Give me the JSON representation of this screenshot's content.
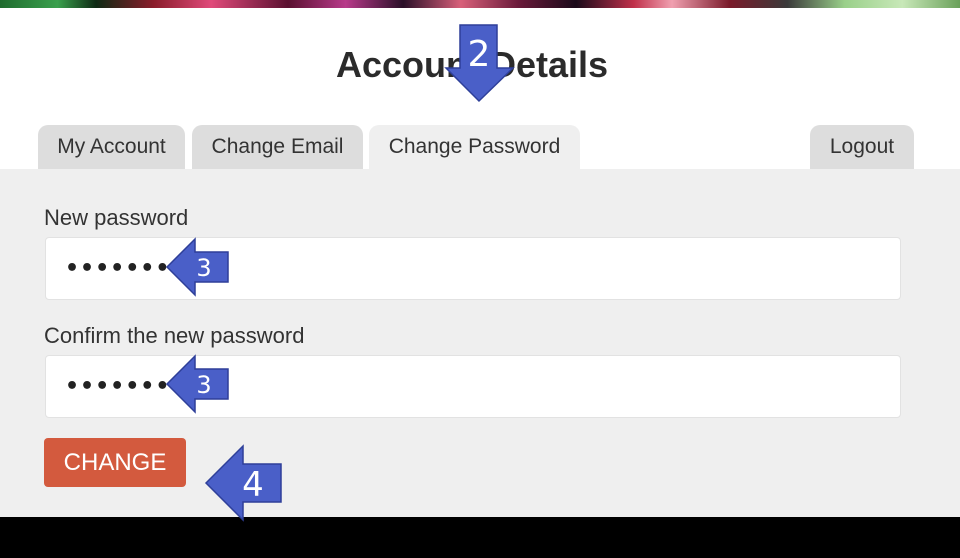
{
  "page": {
    "title": "Account Details"
  },
  "tabs": [
    {
      "label": "My Account",
      "active": false
    },
    {
      "label": "Change Email",
      "active": false
    },
    {
      "label": "Change Password",
      "active": true
    },
    {
      "label": "Logout",
      "active": false
    }
  ],
  "form": {
    "new_password_label": "New password",
    "new_password_value": "•••••••••",
    "confirm_password_label": "Confirm the new password",
    "confirm_password_value": "•••••••••",
    "submit_label": "CHANGE"
  },
  "annotations": {
    "step_2": "2",
    "step_3a": "3",
    "step_3b": "3",
    "step_4": "4"
  },
  "colors": {
    "button": "#d35a3e",
    "panel": "#efefef",
    "tab": "#dddddd",
    "callout": "#4a5fc8"
  }
}
